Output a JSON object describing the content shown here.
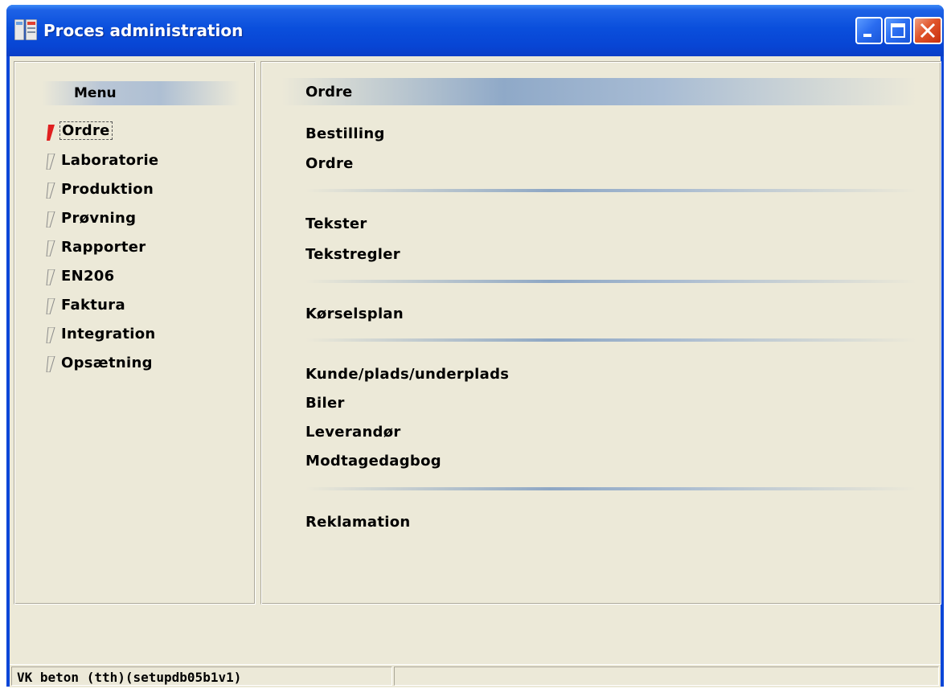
{
  "window": {
    "title": "Proces administration"
  },
  "sidebar": {
    "header": "Menu",
    "items": [
      {
        "label": "Ordre",
        "active": true
      },
      {
        "label": "Laboratorie",
        "active": false
      },
      {
        "label": "Produktion",
        "active": false
      },
      {
        "label": "Prøvning",
        "active": false
      },
      {
        "label": "Rapporter",
        "active": false
      },
      {
        "label": "EN206",
        "active": false
      },
      {
        "label": "Faktura",
        "active": false
      },
      {
        "label": "Integration",
        "active": false
      },
      {
        "label": "Opsætning",
        "active": false
      }
    ]
  },
  "main": {
    "section_title": "Ordre",
    "groups": [
      [
        "Bestilling",
        "Ordre"
      ],
      [
        "Tekster",
        "Tekstregler"
      ],
      [
        "Kørselsplan"
      ],
      [
        "Kunde/plads/underplads",
        "Biler",
        "Leverandør",
        "Modtagedagbog"
      ],
      [
        "Reklamation"
      ]
    ]
  },
  "statusbar": {
    "text": "VK beton (tth)(setupdb05b1v1)"
  },
  "colors": {
    "titlebar": "#0a4fdc",
    "client": "#ece9d8",
    "active_marker": "#e02020",
    "inactive_marker": "#8a8a8a"
  }
}
